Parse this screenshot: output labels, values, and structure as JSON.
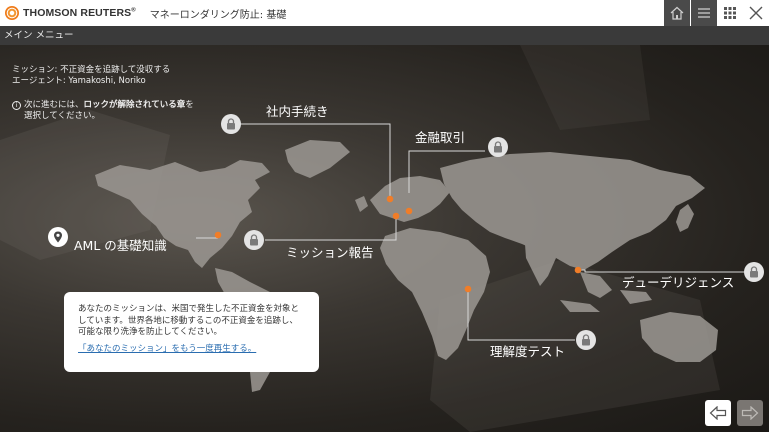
{
  "header": {
    "brand": "THOMSON REUTERS",
    "brand_mark": "®",
    "course_title": "マネーロンダリング防止: 基礎"
  },
  "top_buttons": {
    "home": "home-icon",
    "menu": "menu-icon",
    "grid": "grid-icon",
    "close": "close-icon"
  },
  "menubar": {
    "label": "メイン メニュー"
  },
  "mission": {
    "line1": "ミッション: 不正資金を追跡して没収する",
    "line2": "エージェント: Yamakoshi, Noriko"
  },
  "hint": {
    "icon": "i",
    "pre": "次に進むには、",
    "bold": "ロックが解除されている章",
    "post": "を",
    "line2": "選択してください。"
  },
  "chapters": {
    "aml": "AML の基礎知識",
    "internal": "社内手続き",
    "financial": "金融取引",
    "report": "ミッション報告",
    "due": "デューデリジェンス",
    "test": "理解度テスト"
  },
  "card": {
    "text": "あなたのミッションは、米国で発生した不正資金を対象としています。世界各地に移動するこの不正資金を追跡し、可能な限り洗浄を防止してください。",
    "link": "「あなたのミッション」をもう一度再生する。"
  },
  "colors": {
    "accent": "#f07d28",
    "link": "#2a6db0"
  }
}
